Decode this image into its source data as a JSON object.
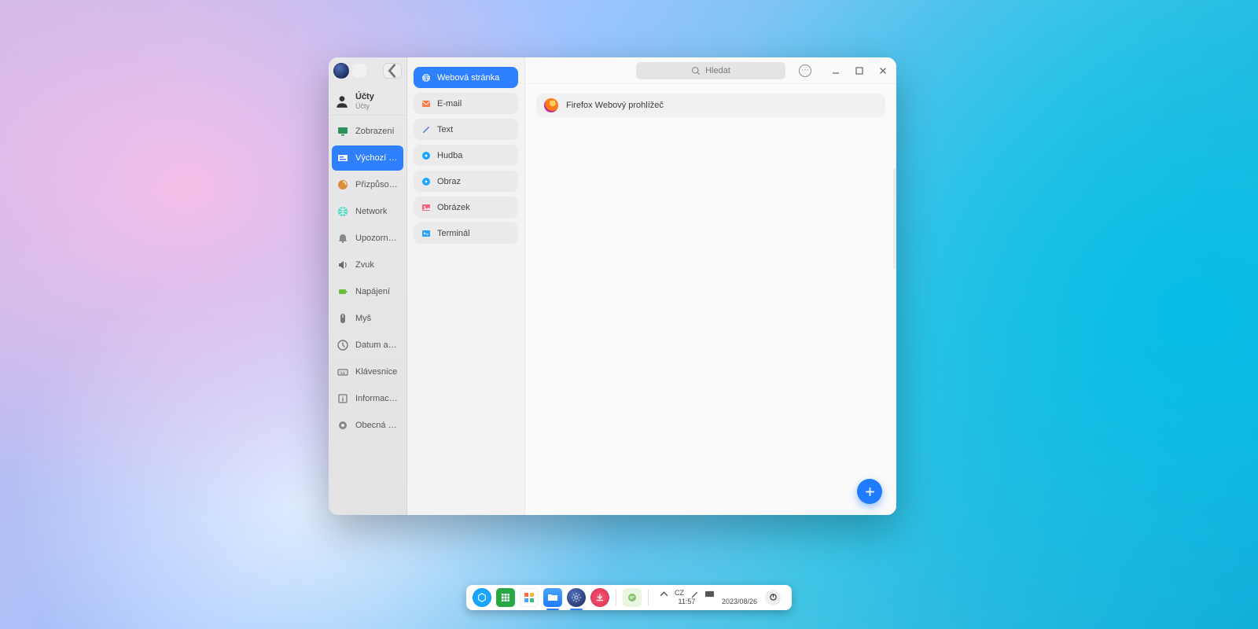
{
  "window": {
    "user_label": "Účty",
    "user_sublabel": "Účty",
    "search_placeholder": "Hledat"
  },
  "sidebar": [
    {
      "id": "display",
      "label": "Zobrazení"
    },
    {
      "id": "defaults",
      "label": "Výchozí pr…",
      "active": true
    },
    {
      "id": "customize",
      "label": "Přizpůsob…"
    },
    {
      "id": "network",
      "label": "Network"
    },
    {
      "id": "notify",
      "label": "Upozornění"
    },
    {
      "id": "sound",
      "label": "Zvuk"
    },
    {
      "id": "power",
      "label": "Napájení"
    },
    {
      "id": "mouse",
      "label": "Myš"
    },
    {
      "id": "datetime",
      "label": "Datum a čas"
    },
    {
      "id": "keyboard",
      "label": "Klávesnice"
    },
    {
      "id": "info",
      "label": "Informace …"
    },
    {
      "id": "general",
      "label": "Obecná na…"
    }
  ],
  "categories": [
    {
      "id": "web",
      "label": "Webová stránka",
      "active": true,
      "color": "#ffffff"
    },
    {
      "id": "email",
      "label": "E-mail",
      "color": "#ff7a45"
    },
    {
      "id": "text",
      "label": "Text",
      "color": "#4a7bd6"
    },
    {
      "id": "music",
      "label": "Hudba",
      "color": "#17a6ff"
    },
    {
      "id": "video",
      "label": "Obraz",
      "color": "#1fa7ff"
    },
    {
      "id": "image",
      "label": "Obrázek",
      "color": "#ff5f7e"
    },
    {
      "id": "terminal",
      "label": "Terminál",
      "color": "#2aa2ff"
    }
  ],
  "default_app": {
    "name": "Firefox Webový prohlížeč"
  },
  "taskbar": {
    "time": "11:57",
    "date": "2023/08/26",
    "lang": "CZ"
  }
}
